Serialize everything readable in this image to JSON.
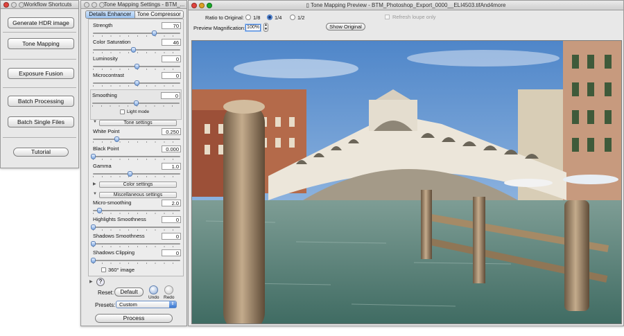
{
  "workflow": {
    "title": "Workflow Shortcuts",
    "buttons": [
      "Generate HDR image",
      "Tone Mapping",
      "Exposure Fusion",
      "Batch Processing",
      "Batch Single Files",
      "Tutorial"
    ]
  },
  "settings": {
    "title": "Tone Mapping Settings - BTM_...",
    "tabs": [
      "Details Enhancer",
      "Tone Compressor"
    ],
    "active_tab": "Details Enhancer",
    "sliders": [
      {
        "label": "Strength",
        "value": "70",
        "level": 0.7
      },
      {
        "label": "Color Saturation",
        "value": "46",
        "level": 0.46
      },
      {
        "label": "Luminosity",
        "value": "0",
        "level": 0.5
      },
      {
        "label": "Microcontrast",
        "value": "0",
        "level": 0.5
      }
    ],
    "smoothing": {
      "label": "Smoothing",
      "value": "0",
      "level": 0.5
    },
    "light_mode_label": "Light mode",
    "tone_settings_label": "Tone settings",
    "tone_sliders": [
      {
        "label": "White Point",
        "value": "0.250",
        "level": 0.27
      },
      {
        "label": "Black Point",
        "value": "0.000",
        "level": 0.0
      },
      {
        "label": "Gamma",
        "value": "1.0",
        "level": 0.42
      }
    ],
    "color_settings_label": "Color settings",
    "misc_settings_label": "Miscellaneous settings",
    "misc_sliders": [
      {
        "label": "Micro-smoothing",
        "value": "2.0",
        "level": 0.07
      },
      {
        "label": "Highlights Smoothness",
        "value": "0",
        "level": 0.0
      },
      {
        "label": "Shadows Smoothness",
        "value": "0",
        "level": 0.0
      },
      {
        "label": "Shadows Clipping",
        "value": "0",
        "level": 0.0
      }
    ],
    "image_360_label": "360° image",
    "help_glyph": "?",
    "reset_label": "Reset:",
    "default_label": "Default",
    "undo_label": "Undo",
    "redo_label": "Redo",
    "presets_label": "Presets:",
    "presets_value": "Custom",
    "process_label": "Process"
  },
  "preview": {
    "title": "Tone Mapping Preview - BTM_Photoshop_Export_0000__ELI4503.tifAnd4more",
    "ratio_label": "Ratio to Original:",
    "ratio_options": [
      "1/8",
      "1/4",
      "1/2"
    ],
    "ratio_selected": "1/4",
    "magnification_label": "Preview Magnification:",
    "magnification_value": "100%",
    "show_original_label": "Show Original",
    "refresh_label": "Refresh loupe only",
    "image_alt": "Rialto Bridge, Venice"
  },
  "colors": {
    "accent": "#3a77d0",
    "traffic_close": "#e0443e",
    "traffic_min": "#dea123",
    "traffic_zoom": "#1aab29"
  }
}
